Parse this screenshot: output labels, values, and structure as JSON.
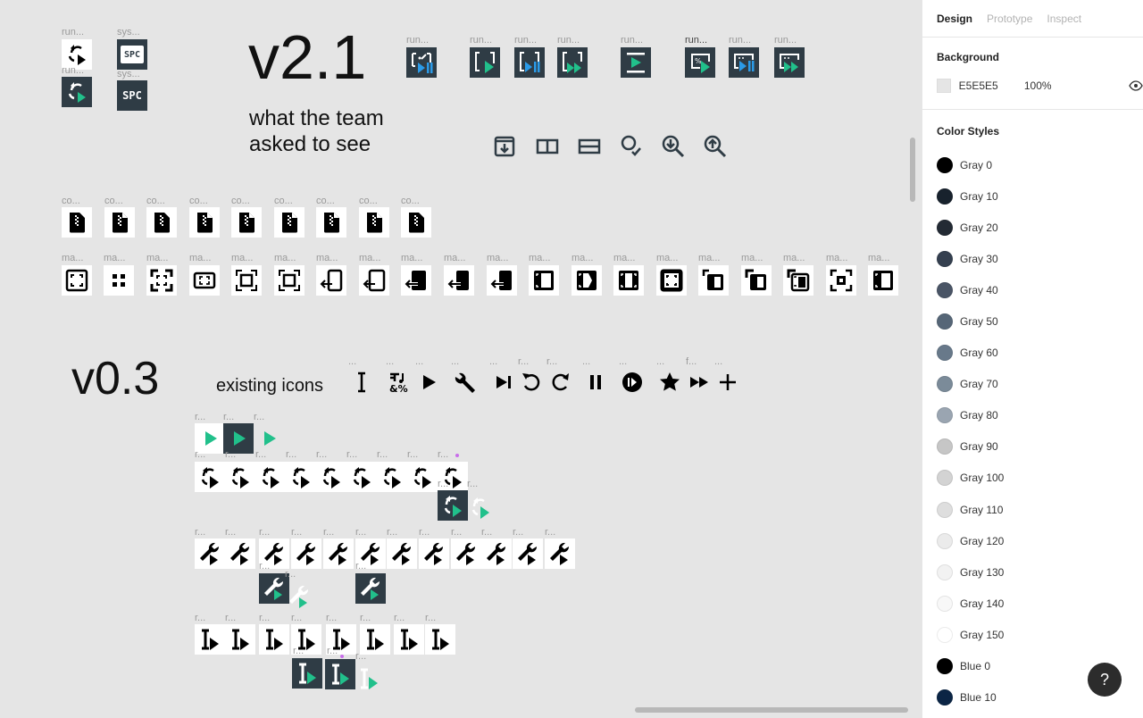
{
  "canvas": {
    "background": "#E5E5E5",
    "v21": {
      "title": "v2.1",
      "subtitle_line1": "what the team",
      "subtitle_line2": "asked to see",
      "run_labels": [
        "run...",
        "run..."
      ],
      "sys_labels": [
        "sys...",
        "sys..."
      ],
      "spc_text": "SPC",
      "top_row_labels": [
        "run...",
        "run...",
        "run...",
        "run...",
        "run...",
        "run...",
        "run...",
        "run..."
      ],
      "toolbar_icons": [
        "download-frame-icon",
        "split-vertical-icon",
        "split-horizontal-icon",
        "search-check-icon",
        "zoom-download-icon",
        "zoom-upload-icon"
      ],
      "co_labels": [
        "co...",
        "co...",
        "co...",
        "co...",
        "co...",
        "co...",
        "co...",
        "co...",
        "co..."
      ],
      "ma_labels": [
        "ma...",
        "ma...",
        "ma...",
        "ma...",
        "ma...",
        "ma...",
        "ma...",
        "ma...",
        "ma...",
        "ma...",
        "ma...",
        "ma...",
        "ma...",
        "ma...",
        "ma...",
        "ma...",
        "ma...",
        "ma...",
        "ma...",
        "ma..."
      ]
    },
    "v03": {
      "title": "v0.3",
      "subtitle": "existing icons",
      "existing_labels": [
        "...",
        "...",
        "...",
        "...",
        "...",
        "r...",
        "r...",
        "...",
        "...",
        "...",
        "f...",
        "..."
      ],
      "r_label": "r...",
      "play_row_count": 3,
      "sync_row_count": 9,
      "wrench_row_count": 12,
      "cursor_row_count": 8
    }
  },
  "panel": {
    "tabs": [
      "Design",
      "Prototype",
      "Inspect"
    ],
    "active_tab": "Design",
    "background": {
      "title": "Background",
      "hex": "E5E5E5",
      "opacity": "100%",
      "swatch": "#E5E5E5"
    },
    "color_styles": {
      "title": "Color Styles",
      "items": [
        {
          "name": "Gray 0",
          "color": "#000000"
        },
        {
          "name": "Gray 10",
          "color": "#18222d"
        },
        {
          "name": "Gray 20",
          "color": "#232a34"
        },
        {
          "name": "Gray 30",
          "color": "#343f4f"
        },
        {
          "name": "Gray 40",
          "color": "#4a5566"
        },
        {
          "name": "Gray 50",
          "color": "#566677"
        },
        {
          "name": "Gray 60",
          "color": "#68798a"
        },
        {
          "name": "Gray 70",
          "color": "#7b8b99"
        },
        {
          "name": "Gray 80",
          "color": "#9aa5b1"
        },
        {
          "name": "Gray 90",
          "color": "#c6c6c6"
        },
        {
          "name": "Gray 100",
          "color": "#d3d3d3"
        },
        {
          "name": "Gray 110",
          "color": "#dedede"
        },
        {
          "name": "Gray 120",
          "color": "#ebebeb"
        },
        {
          "name": "Gray 130",
          "color": "#f2f2f2"
        },
        {
          "name": "Gray 140",
          "color": "#f8f8f8"
        },
        {
          "name": "Gray 150",
          "color": "#ffffff"
        },
        {
          "name": "Blue 0",
          "color": "#000000"
        },
        {
          "name": "Blue 10",
          "color": "#0b2545"
        }
      ]
    },
    "help_label": "?"
  },
  "colors": {
    "accent_green": "#21c08b",
    "accent_blue": "#2b9be8",
    "icon_dark_bg": "#2f3c45",
    "marker_purple": "#c86dea"
  }
}
